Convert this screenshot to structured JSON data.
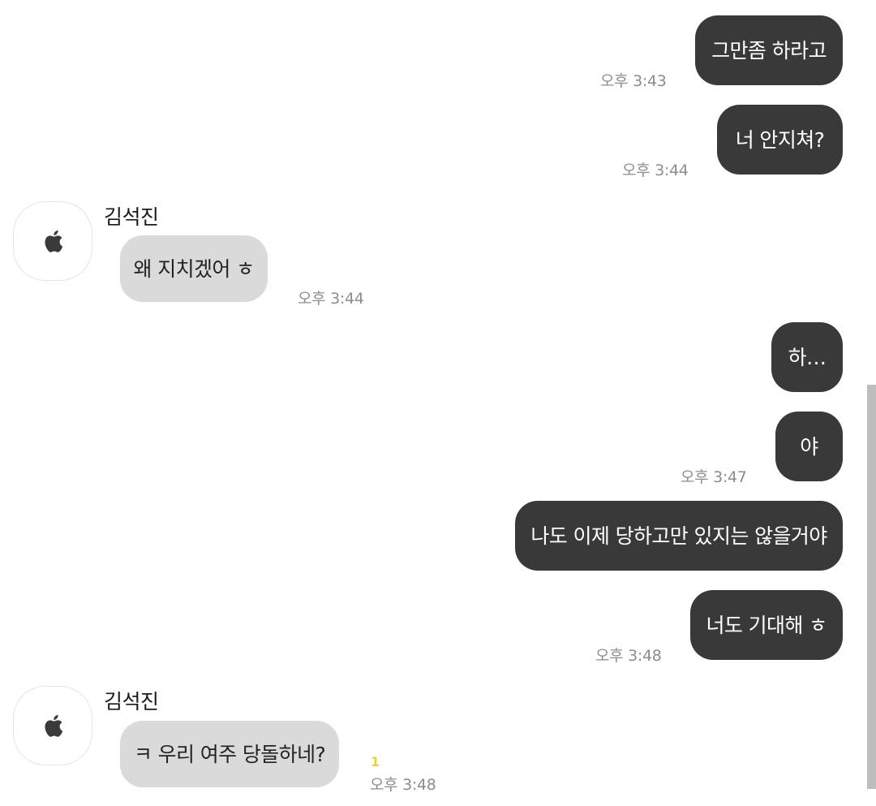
{
  "messages": {
    "m1": {
      "text": "그만좀 하라고",
      "time": "오후 3:43"
    },
    "m2": {
      "text": "너 안지쳐?",
      "time": "오후 3:44"
    },
    "m3": {
      "sender": "김석진",
      "text": "왜 지치겠어 ㅎ",
      "time": "오후 3:44"
    },
    "m4": {
      "text": "하…"
    },
    "m5": {
      "text": "야",
      "time": "오후 3:47"
    },
    "m6": {
      "text": "나도 이제 당하고만 있지는 않을거야"
    },
    "m7": {
      "text": "너도 기대해 ㅎ",
      "time": "오후 3:48"
    },
    "m8": {
      "sender": "김석진",
      "text": "ㅋ 우리 여주 당돌하네?",
      "time": "오후 3:48",
      "unread": "1"
    }
  },
  "avatar_icon": "apple-logo-icon",
  "colors": {
    "my_bubble": "#393939",
    "other_bubble": "#dadada",
    "unread_badge": "#e8d23a"
  }
}
